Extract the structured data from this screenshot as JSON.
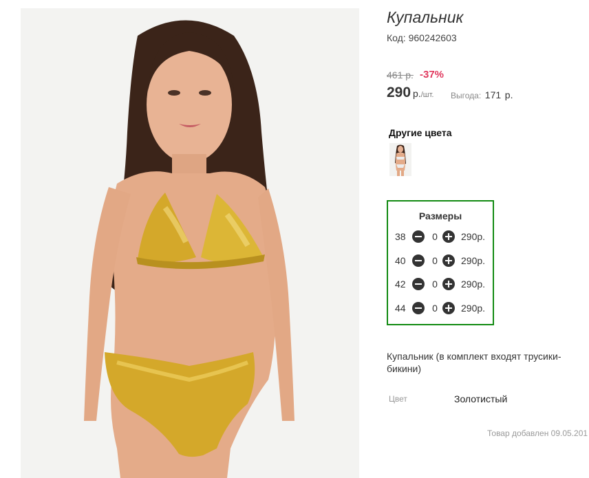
{
  "product": {
    "title": "Купальник",
    "code_label": "Код:",
    "code_value": "960242603",
    "old_price": "461 р.",
    "discount": "-37%",
    "price": "290",
    "price_currency": "р.",
    "price_unit": "/шт.",
    "savings_label": "Выгода:",
    "savings_value": "171",
    "savings_currency": "р."
  },
  "other_colors": {
    "title": "Другие цвета",
    "thumb_icon": "swimsuit-thumbnail"
  },
  "sizes": {
    "title": "Размеры",
    "rows": [
      {
        "size": "38",
        "qty": "0",
        "price": "290р."
      },
      {
        "size": "40",
        "qty": "0",
        "price": "290р."
      },
      {
        "size": "42",
        "qty": "0",
        "price": "290р."
      },
      {
        "size": "44",
        "qty": "0",
        "price": "290р."
      }
    ],
    "minus_icon": "minus-circle-icon",
    "plus_icon": "plus-circle-icon",
    "border_color": "#118a11"
  },
  "description": "Купальник (в комплект входят трусики-бикини)",
  "attributes": {
    "color_label": "Цвет",
    "color_value": "Золотистый"
  },
  "added_text": "Товар добавлен 09.05.201",
  "colors": {
    "discount": "#e0395e",
    "accent_gold": "#d4a82a"
  }
}
